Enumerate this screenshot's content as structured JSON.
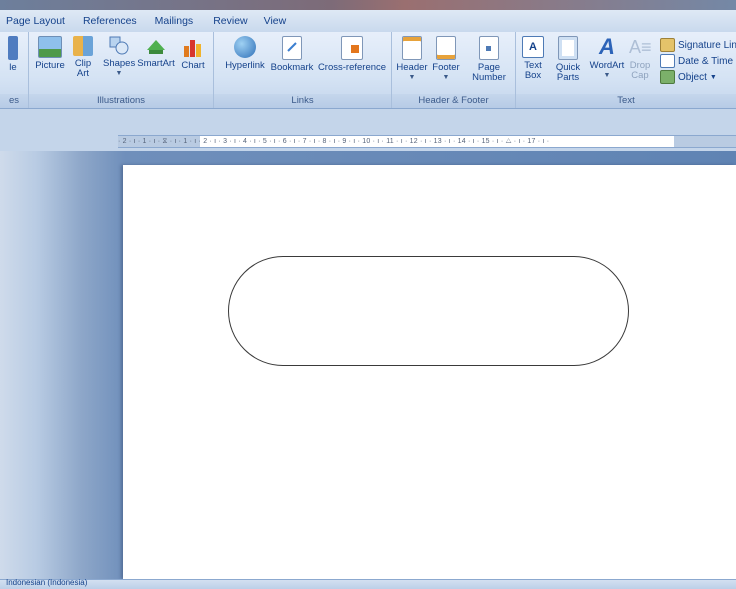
{
  "tabs": [
    "Page Layout",
    "References",
    "Mailings",
    "Review",
    "View"
  ],
  "ribbon": {
    "partial_left": {
      "button": "le",
      "group": "es"
    },
    "illustrations": {
      "label": "Illustrations",
      "buttons": [
        "Picture",
        "Clip Art",
        "Shapes",
        "SmartArt",
        "Chart"
      ]
    },
    "links": {
      "label": "Links",
      "buttons": [
        "Hyperlink",
        "Bookmark",
        "Cross-reference"
      ]
    },
    "header_footer": {
      "label": "Header & Footer",
      "buttons": [
        "Header",
        "Footer",
        "Page Number"
      ]
    },
    "text": {
      "label": "Text",
      "buttons": [
        "Text Box",
        "Quick Parts",
        "WordArt",
        "Drop Cap"
      ],
      "small": [
        "Signature Lin",
        "Date & Time",
        "Object"
      ]
    }
  },
  "ruler_text": "· 2 · ı · 1 · ı · ⧖ · ı · 1 · ı · 2 · ı · 3 · ı · 4 · ı · 5 · ı · 6 · ı · 7 · ı · 8 · ı · 9 · ı · 10 · ı · 11 · ı · 12 · ı · 13 · ı · 14 · ı · 15 · ı · △ · ı · 17 · ı ·",
  "status": {
    "language": "Indonesian (Indonesia)"
  },
  "colors": {
    "ribbon_text": "#15428b",
    "workspace": "#5f83b3",
    "page": "#ffffff"
  }
}
